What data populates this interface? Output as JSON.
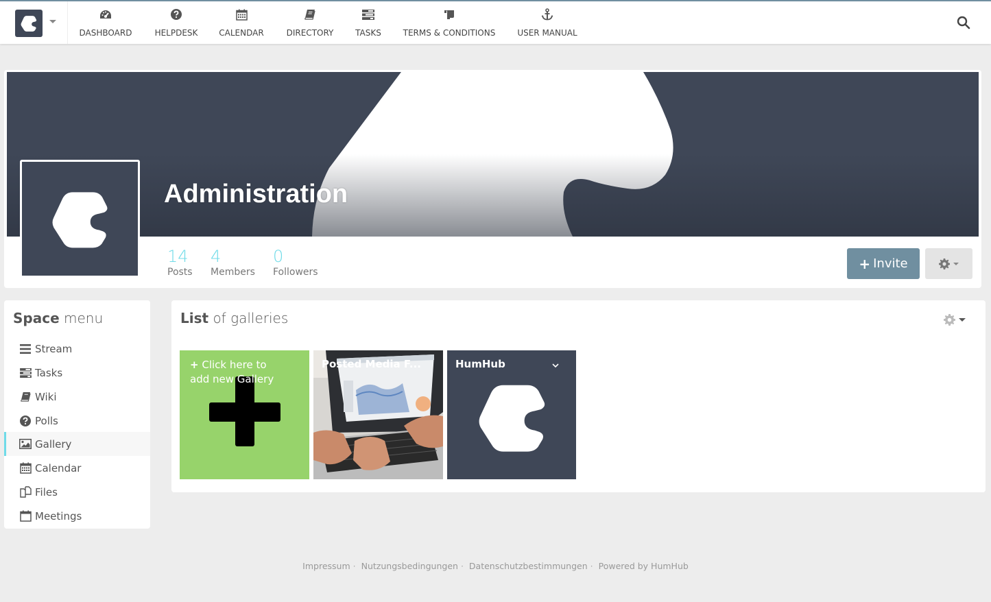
{
  "topbar": {
    "nav": [
      {
        "label": "DASHBOARD",
        "icon": "dashboard-icon"
      },
      {
        "label": "HELPDESK",
        "icon": "question-circle-icon"
      },
      {
        "label": "CALENDAR",
        "icon": "calendar-icon"
      },
      {
        "label": "DIRECTORY",
        "icon": "book-icon"
      },
      {
        "label": "TASKS",
        "icon": "tasks-icon"
      },
      {
        "label": "TERMS & CONDITIONS",
        "icon": "scroll-icon"
      },
      {
        "label": "USER MANUAL",
        "icon": "anchor-icon"
      }
    ]
  },
  "space": {
    "title": "Administration",
    "stats": [
      {
        "value": "14",
        "label": "Posts"
      },
      {
        "value": "4",
        "label": "Members"
      },
      {
        "value": "0",
        "label": "Followers"
      }
    ],
    "invite_label": "Invite"
  },
  "sidebar": {
    "title_bold": "Space",
    "title_light": "menu",
    "items": [
      {
        "label": "Stream",
        "icon": "bars-icon"
      },
      {
        "label": "Tasks",
        "icon": "tasks-icon"
      },
      {
        "label": "Wiki",
        "icon": "book-icon"
      },
      {
        "label": "Polls",
        "icon": "question-circle-icon"
      },
      {
        "label": "Gallery",
        "icon": "image-icon",
        "active": true
      },
      {
        "label": "Calendar",
        "icon": "calendar-icon"
      },
      {
        "label": "Files",
        "icon": "files-icon"
      },
      {
        "label": "Meetings",
        "icon": "calendar-blank-icon"
      }
    ]
  },
  "gallery": {
    "title_bold": "List",
    "title_light": "of galleries",
    "add_line1": "Click here to",
    "add_line2": "add new Gallery",
    "items": [
      {
        "caption": "Posted Media F..."
      },
      {
        "caption": "HumHub"
      }
    ]
  },
  "footer": {
    "links": [
      "Impressum",
      "Nutzungsbedingungen",
      "Datenschutzbestimmungen",
      "Powered by HumHub"
    ]
  },
  "colors": {
    "brand_dark": "#3f4757",
    "accent": "#6fdbe8",
    "invite": "#708fa0",
    "add_tile": "#97d36b"
  }
}
